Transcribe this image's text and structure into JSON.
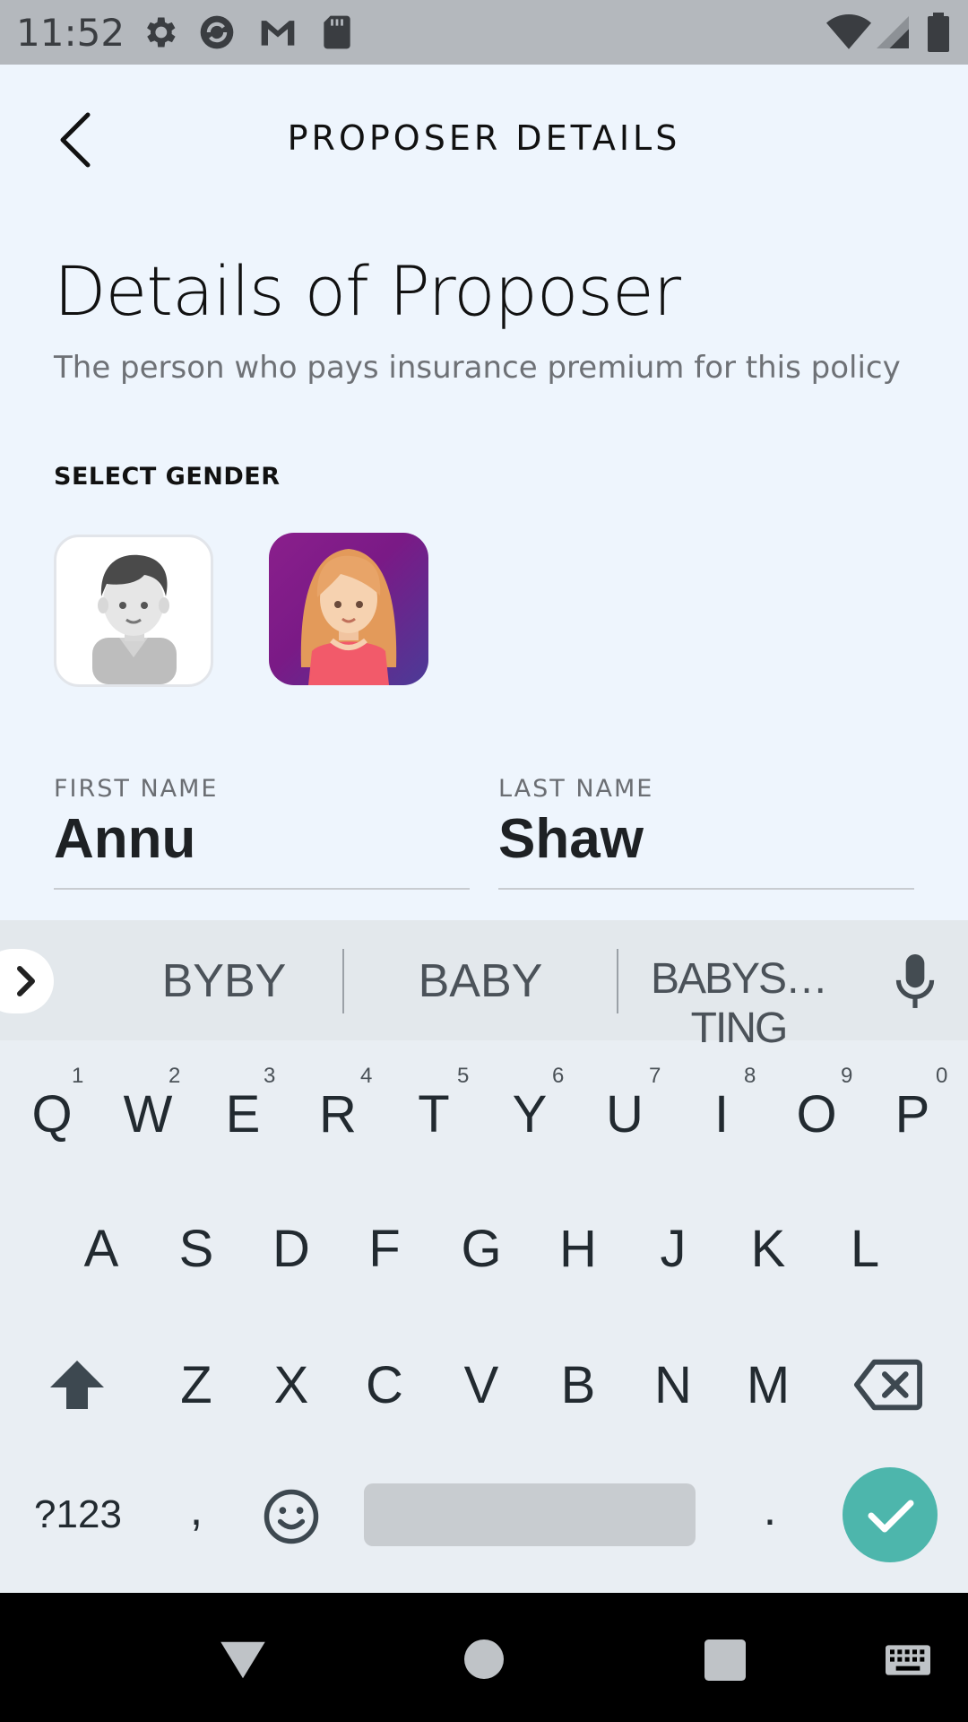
{
  "status_bar": {
    "time": "11:52"
  },
  "header": {
    "title": "PROPOSER DETAILS"
  },
  "page": {
    "title": "Details of Proposer",
    "subtitle": "The person who pays insurance premium for this policy"
  },
  "gender": {
    "label": "SELECT GENDER",
    "options": [
      "male",
      "female"
    ],
    "selected": "female"
  },
  "form": {
    "first_name": {
      "label": "FIRST NAME",
      "value": "Annu"
    },
    "last_name": {
      "label": "LAST NAME",
      "value": "Shaw"
    }
  },
  "keyboard": {
    "suggestions": [
      "BYBY",
      "BABY",
      "BABYS…TING"
    ],
    "row1": [
      "Q",
      "W",
      "E",
      "R",
      "T",
      "Y",
      "U",
      "I",
      "O",
      "P"
    ],
    "row1_hints": [
      "1",
      "2",
      "3",
      "4",
      "5",
      "6",
      "7",
      "8",
      "9",
      "0"
    ],
    "row2": [
      "A",
      "S",
      "D",
      "F",
      "G",
      "H",
      "J",
      "K",
      "L"
    ],
    "row3": [
      "Z",
      "X",
      "C",
      "V",
      "B",
      "N",
      "M"
    ],
    "symbols_label": "?123",
    "comma": ",",
    "period": "."
  },
  "colors": {
    "accent": "#4db6ac",
    "female_card": "#7a1a86"
  }
}
